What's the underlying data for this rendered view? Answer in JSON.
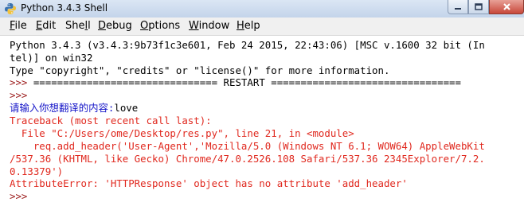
{
  "window": {
    "title": "Python 3.4.3 Shell"
  },
  "menu": [
    {
      "pre": "",
      "u": "F",
      "post": "ile"
    },
    {
      "pre": "",
      "u": "E",
      "post": "dit"
    },
    {
      "pre": "She",
      "u": "l",
      "post": "l"
    },
    {
      "pre": "",
      "u": "D",
      "post": "ebug"
    },
    {
      "pre": "",
      "u": "O",
      "post": "ptions"
    },
    {
      "pre": "",
      "u": "W",
      "post": "indow"
    },
    {
      "pre": "",
      "u": "H",
      "post": "elp"
    }
  ],
  "shell": {
    "banner1": "Python 3.4.3 (v3.4.3:9b73f1c3e601, Feb 24 2015, 22:43:06) [MSC v.1600 32 bit (In",
    "banner2": "tel)] on win32",
    "banner3": "Type \"copyright\", \"credits\" or \"license()\" for more information.",
    "prompt": ">>> ",
    "restart": "=============================== RESTART ================================",
    "prompt_only": ">>>",
    "input_prompt": "请输入你想翻译的内容:",
    "input_value": "love",
    "tb1": "Traceback (most recent call last):",
    "tb2": "  File \"C:/Users/ome/Desktop/res.py\", line 21, in <module>",
    "tb3": "    req.add_header('User-Agent','Mozilla/5.0 (Windows NT 6.1; WOW64) AppleWebKit",
    "tb4": "/537.36 (KHTML, like Gecko) Chrome/47.0.2526.108 Safari/537.36 2345Explorer/7.2.",
    "tb5": "0.13379')",
    "error": "AttributeError: 'HTTPResponse' object has no attribute 'add_header'",
    "last_prompt": ">>>"
  }
}
